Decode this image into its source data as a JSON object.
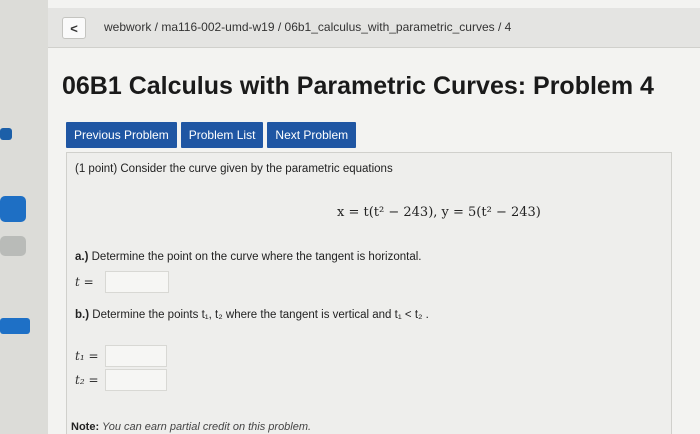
{
  "breadcrumb": "webwork / ma116-002-umd-w19 / 06b1_calculus_with_parametric_curves / 4",
  "back_glyph": "<",
  "title": "06B1 Calculus with Parametric Curves: Problem 4",
  "nav": {
    "previous": "Previous Problem",
    "list": "Problem List",
    "next": "Next Problem"
  },
  "problem": {
    "intro": "(1 point) Consider the curve given by the parametric equations",
    "equation": "x = t(t² − 243),   y = 5(t² − 243)",
    "part_a_label": "a.)",
    "part_a_text": " Determine the point on the curve where the tangent is horizontal.",
    "t_label": "t =",
    "t_value": "",
    "part_b_label": "b.)",
    "part_b_text": " Determine the points t₁, t₂ where the tangent is vertical and t₁ < t₂ .",
    "t1_label": "t₁ =",
    "t1_value": "",
    "t2_label": "t₂ =",
    "t2_value": "",
    "note_label": "Note:",
    "note_text": " You can earn partial credit on this problem."
  },
  "colors": {
    "nav_button": "#1f56a3",
    "background": "#f3f3f1"
  }
}
